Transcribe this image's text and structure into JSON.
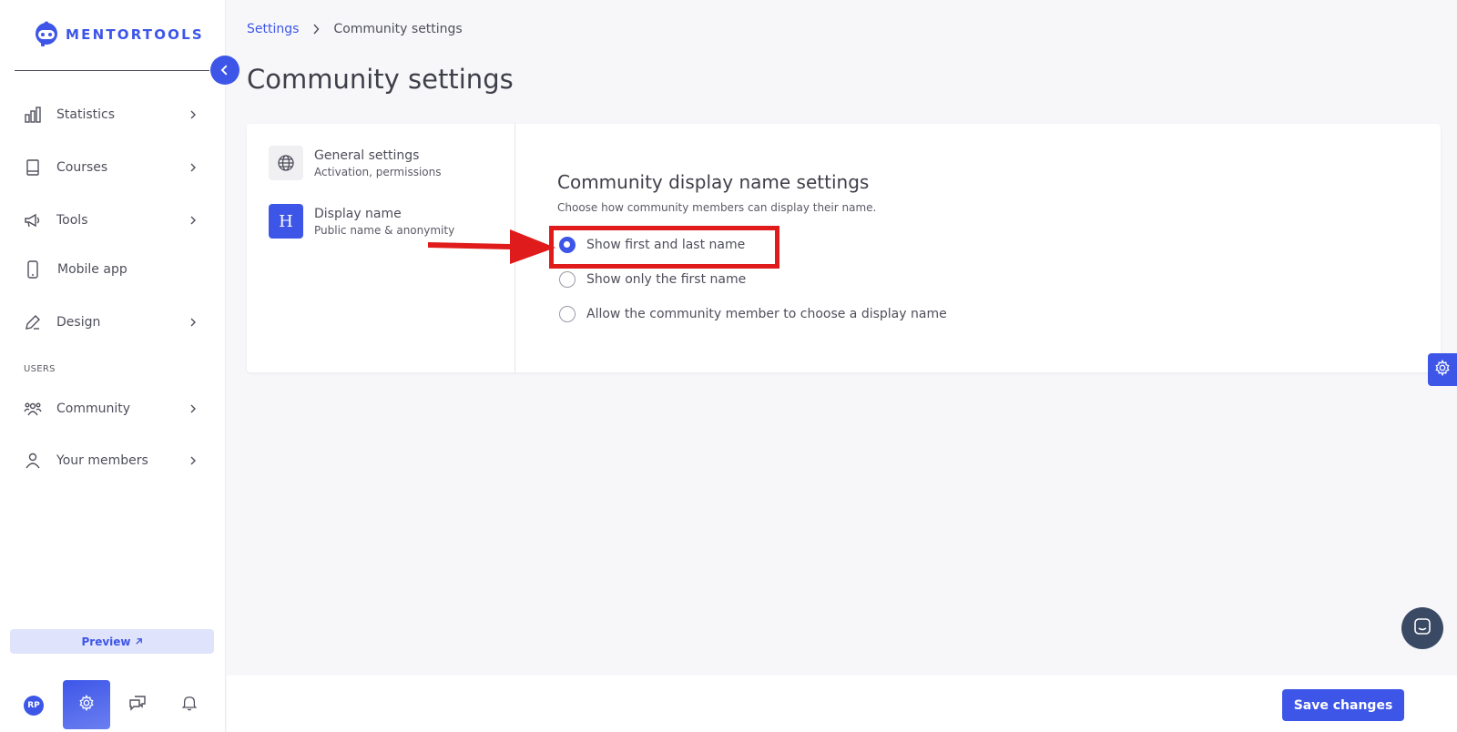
{
  "brand": {
    "name": "MENTORTOOLS",
    "accent": "#3d56e8"
  },
  "sidebar": {
    "items": [
      {
        "label": "Statistics",
        "icon": "bar-chart-icon",
        "has_chevron": true
      },
      {
        "label": "Courses",
        "icon": "book-icon",
        "has_chevron": true
      },
      {
        "label": "Tools",
        "icon": "megaphone-icon",
        "has_chevron": true
      },
      {
        "label": "Mobile app",
        "icon": "mobile-phone-icon",
        "has_chevron": false
      },
      {
        "label": "Design",
        "icon": "pencil-icon",
        "has_chevron": true
      }
    ],
    "users_section_label": "USERS",
    "user_items": [
      {
        "label": "Community",
        "icon": "community-icon",
        "has_chevron": true
      },
      {
        "label": "Your members",
        "icon": "user-icon",
        "has_chevron": true
      }
    ],
    "preview_label": "Preview",
    "avatar_initials": "RP"
  },
  "breadcrumb": {
    "parent": "Settings",
    "current": "Community settings"
  },
  "page_title": "Community settings",
  "settings_tabs": [
    {
      "title": "General settings",
      "subtitle": "Activation, permissions",
      "icon": "globe-icon"
    },
    {
      "title": "Display name",
      "subtitle": "Public name & anonymity",
      "icon_letter": "H"
    }
  ],
  "display_name_section": {
    "title": "Community display name settings",
    "description": "Choose how community members can display their name.",
    "options": [
      {
        "label": "Show first and last name",
        "selected": true
      },
      {
        "label": "Show only the first name",
        "selected": false
      },
      {
        "label": "Allow the community member to choose a display name",
        "selected": false
      }
    ]
  },
  "footer": {
    "save_label": "Save changes"
  },
  "annotation_color": "#e01b1b"
}
